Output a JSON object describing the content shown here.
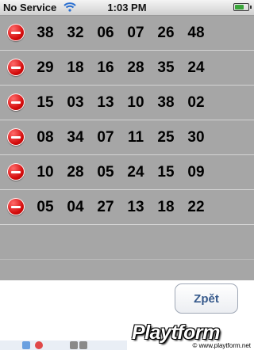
{
  "status_bar": {
    "carrier": "No Service",
    "wifi_icon": "wifi-icon",
    "time": "1:03 PM",
    "battery_level": 0.7
  },
  "rows": [
    {
      "numbers": [
        "38",
        "32",
        "06",
        "07",
        "26",
        "48"
      ]
    },
    {
      "numbers": [
        "29",
        "18",
        "16",
        "28",
        "35",
        "24"
      ]
    },
    {
      "numbers": [
        "15",
        "03",
        "13",
        "10",
        "38",
        "02"
      ]
    },
    {
      "numbers": [
        "08",
        "34",
        "07",
        "11",
        "25",
        "30"
      ]
    },
    {
      "numbers": [
        "10",
        "28",
        "05",
        "24",
        "15",
        "09"
      ]
    },
    {
      "numbers": [
        "05",
        "04",
        "27",
        "13",
        "18",
        "22"
      ]
    }
  ],
  "back_button": {
    "label": "Zpět"
  },
  "watermark": {
    "logo": "Playtform",
    "url": "© www.playtform.net"
  },
  "colors": {
    "table_background": "#a6a6a6",
    "delete_red": "#d40b0b",
    "button_text": "#375a8c"
  }
}
